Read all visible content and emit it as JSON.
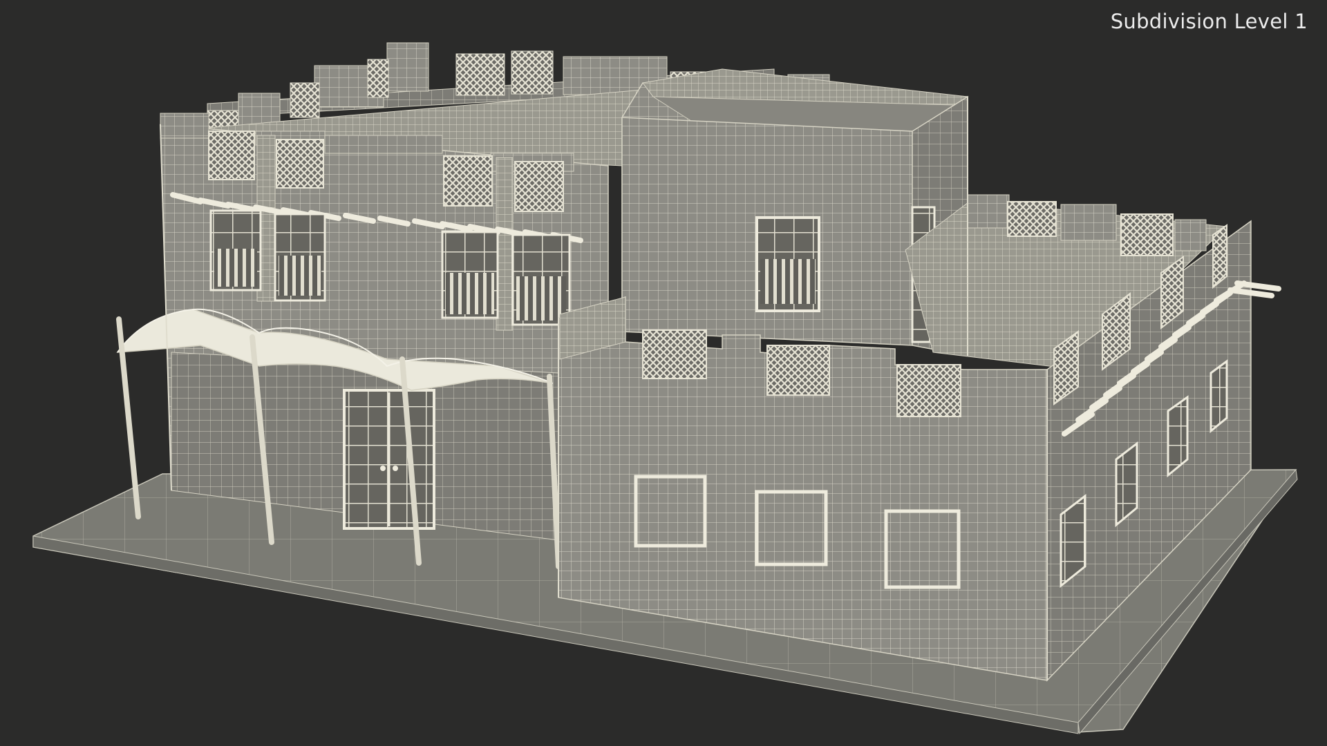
{
  "viewport": {
    "label": "Subdivision Level 1",
    "background_color": "#2b2b2a"
  },
  "model": {
    "wall_color": "#8b8a83",
    "wire_color": "#d6d3c4",
    "canopy_color": "#ecebe0",
    "base_color": "#7a7a73"
  }
}
